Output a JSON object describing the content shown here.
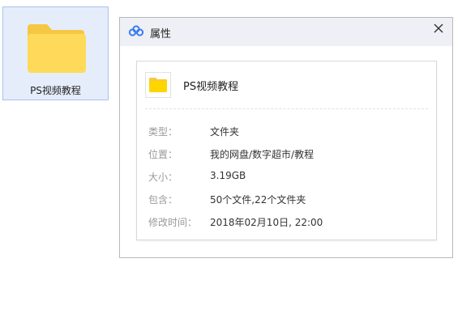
{
  "desktop": {
    "folder_label": "PS视频教程",
    "folder_icon": "folder-icon"
  },
  "dialog": {
    "title": "属性",
    "logo_icon": "baidu-netdisk-logo-icon",
    "close_icon": "close-icon",
    "file_icon": "folder-icon",
    "file_name": "PS视频教程",
    "properties": [
      {
        "key": "类型：",
        "value": "文件夹"
      },
      {
        "key": "位置：",
        "value": "我的网盘/数字超市/教程"
      },
      {
        "key": "大小：",
        "value": "3.19GB"
      },
      {
        "key": "包含：",
        "value": "50个文件,22个文件夹"
      },
      {
        "key": "修改时间：",
        "value": "2018年02月10日, 22:00"
      }
    ]
  },
  "colors": {
    "folder_body": "#ffd95a",
    "folder_tab": "#f4c842",
    "title_bar": "#eef0f6",
    "selection_bg": "#e5edfb",
    "logo_blue": "#3a7bf2"
  }
}
